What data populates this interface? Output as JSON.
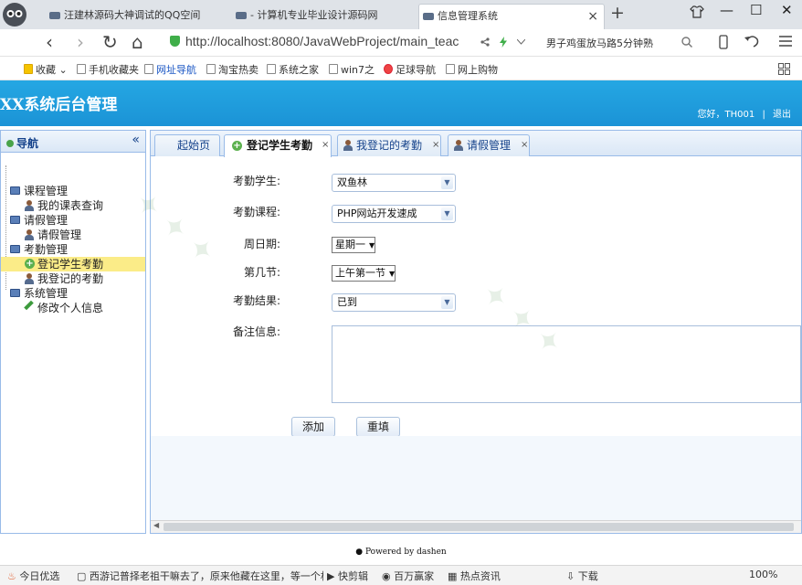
{
  "browser": {
    "tabs": [
      {
        "title": "汪建林源码大神调试的QQ空间",
        "active": false
      },
      {
        "title": "- 计算机专业毕业设计源码网",
        "active": false
      },
      {
        "title": "信息管理系统",
        "active": true
      }
    ],
    "url": "http://localhost:8080/JavaWebProject/main_teac",
    "search_text": "男子鸡蛋放马路5分钟熟",
    "bookmarks": [
      "收藏",
      "手机收藏夹",
      "网址导航",
      "淘宝热卖",
      "系统之家",
      "win7之",
      "足球导航",
      "网上购物"
    ],
    "nav_back": "‹",
    "nav_forward": "›",
    "nav_refresh": "↻",
    "nav_home": "⌂",
    "new_tab": "+",
    "window_controls": [
      "—",
      "☐",
      "✕"
    ]
  },
  "app": {
    "title": "XX系统后台管理",
    "user_greeting": "您好，TH001",
    "logout": "退出",
    "footer": "Powered by dashen"
  },
  "sidebar": {
    "title": "导航",
    "collapse": "«",
    "nodes": [
      {
        "label": "课程管理",
        "level": 0,
        "icon": "computer-icon"
      },
      {
        "label": "我的课表查询",
        "level": 1,
        "icon": "person-icon"
      },
      {
        "label": "请假管理",
        "level": 0,
        "icon": "computer-icon"
      },
      {
        "label": "请假管理",
        "level": 1,
        "icon": "person-icon"
      },
      {
        "label": "考勤管理",
        "level": 0,
        "icon": "computer-icon"
      },
      {
        "label": "登记学生考勤",
        "level": 1,
        "icon": "add-icon",
        "selected": true
      },
      {
        "label": "我登记的考勤",
        "level": 1,
        "icon": "person-icon"
      },
      {
        "label": "系统管理",
        "level": 0,
        "icon": "computer-icon"
      },
      {
        "label": "修改个人信息",
        "level": 1,
        "icon": "pencil-icon"
      }
    ]
  },
  "main_tabs": [
    {
      "label": "起始页",
      "closable": false
    },
    {
      "label": "登记学生考勤",
      "closable": true,
      "active": true
    },
    {
      "label": "我登记的考勤",
      "closable": true
    },
    {
      "label": "请假管理",
      "closable": true
    }
  ],
  "tab_close": "×",
  "form": {
    "student_label": "考勤学生:",
    "student_value": "双鱼林",
    "course_label": "考勤课程:",
    "course_value": "PHP网站开发速成",
    "weekday_label": "周日期:",
    "weekday_value": "星期一",
    "period_label": "第几节:",
    "period_value": "上午第一节",
    "result_label": "考勤结果:",
    "result_value": "已到",
    "remark_label": "备注信息:",
    "remark_value": "",
    "add_button": "添加",
    "reset_button": "重填"
  },
  "statusbar": {
    "items": [
      "今日优选",
      "西游记普择老祖干嘛去了，原来他藏在这里，等一个机缘",
      "快剪辑",
      "百万赢家",
      "热点资讯",
      "下载",
      "100%"
    ]
  }
}
